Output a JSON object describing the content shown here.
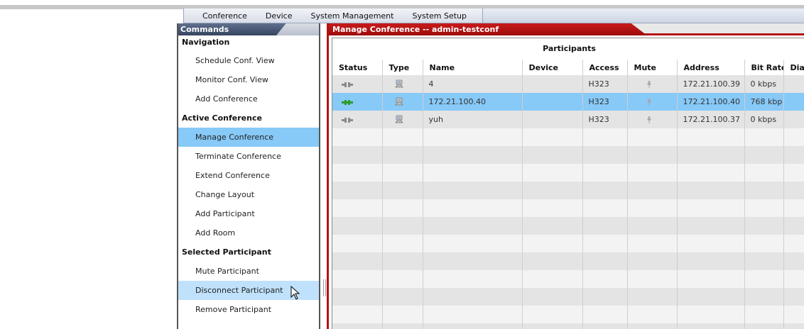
{
  "menubar": {
    "items": [
      "Conference",
      "Device",
      "System Management",
      "System Setup"
    ]
  },
  "sidebar": {
    "header": "Commands",
    "navigation": {
      "title": "Navigation",
      "items": [
        "Schedule Conf. View",
        "Monitor Conf. View",
        "Add Conference"
      ]
    },
    "active_conference": {
      "title": "Active Conference",
      "items": [
        "Manage Conference",
        "Terminate Conference",
        "Extend Conference",
        "Change Layout",
        "Add Participant",
        "Add Room"
      ]
    },
    "selected_participant": {
      "title": "Selected Participant",
      "items": [
        "Mute Participant",
        "Disconnect Participant",
        "Remove Participant"
      ]
    }
  },
  "panel": {
    "title": "Manage Conference -- admin-testconf",
    "grid_caption": "Participants",
    "columns": [
      "Status",
      "Type",
      "Name",
      "Device",
      "Access",
      "Mute",
      "Address",
      "Bit Rate",
      "Dia"
    ],
    "rows": [
      {
        "status": "disconnected",
        "type": "endpoint",
        "name": "4",
        "device": "",
        "access": "H323",
        "mute": "mic",
        "address": "172.21.100.39",
        "bitrate": "0 kbps",
        "selected": false
      },
      {
        "status": "connected",
        "type": "endpoint",
        "name": "172.21.100.40",
        "device": "",
        "access": "H323",
        "mute": "mic",
        "address": "172.21.100.40",
        "bitrate": "768 kbp",
        "selected": true
      },
      {
        "status": "disconnected",
        "type": "endpoint",
        "name": "yuh",
        "device": "",
        "access": "H323",
        "mute": "mic",
        "address": "172.21.100.37",
        "bitrate": "0 kbps",
        "selected": false
      }
    ]
  },
  "colors": {
    "accent_red": "#b41212",
    "selection_blue": "#87c9f7",
    "connected_green": "#2a9d2a"
  }
}
